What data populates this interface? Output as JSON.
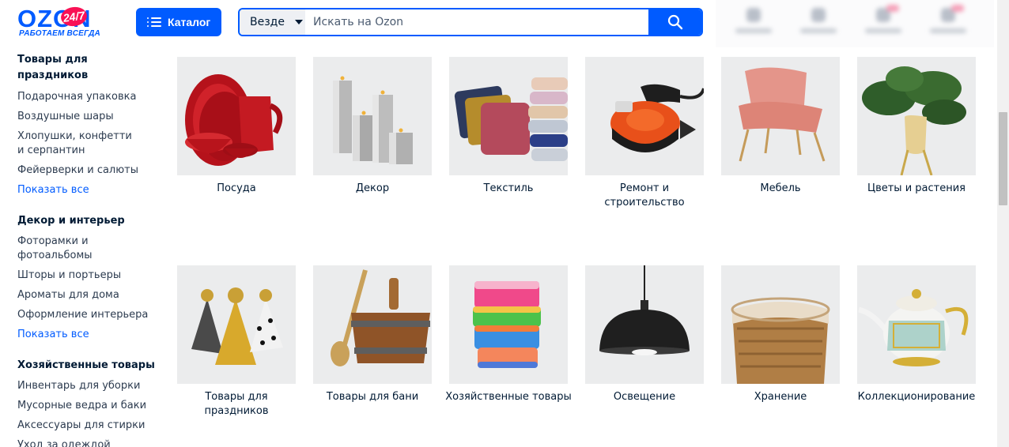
{
  "header": {
    "logo": {
      "word": "OZON",
      "badge": "24/7",
      "slogan": "РАБОТАЕМ ВСЕГДА"
    },
    "catalog_label": "Каталог",
    "search": {
      "scope": "Везде",
      "placeholder": "Искать на Ozon"
    }
  },
  "sidebar": {
    "sections": [
      {
        "title": "Товары для праздников",
        "items": [
          "Подарочная упаковка",
          "Воздушные шары",
          "Хлопушки, конфетти и серпантин",
          "Фейерверки и салюты"
        ],
        "more": "Показать все"
      },
      {
        "title": "Декор и интерьер",
        "items": [
          "Фоторамки и фотоальбомы",
          "Шторы и портьеры",
          "Ароматы для дома",
          "Оформление интерьера"
        ],
        "more": "Показать все"
      },
      {
        "title": "Хозяйственные товары",
        "items": [
          "Инвентарь для уборки",
          "Мусорные ведра и баки",
          "Аксессуары для стирки",
          "Уход за одеждой и обувью"
        ]
      }
    ]
  },
  "categories": [
    {
      "label": "Посуда",
      "icon": "dishes-icon"
    },
    {
      "label": "Декор",
      "icon": "candles-icon"
    },
    {
      "label": "Текстиль",
      "icon": "pillows-icon"
    },
    {
      "label": "Ремонт и строительство",
      "icon": "sander-icon"
    },
    {
      "label": "Мебель",
      "icon": "armchair-icon"
    },
    {
      "label": "Цветы и растения",
      "icon": "plant-icon"
    },
    {
      "label": "Товары для праздников",
      "icon": "party-hats-icon"
    },
    {
      "label": "Товары для бани",
      "icon": "sauna-bucket-icon"
    },
    {
      "label": "Хозяйственные товары",
      "icon": "sponges-icon"
    },
    {
      "label": "Освещение",
      "icon": "pendant-lamp-icon"
    },
    {
      "label": "Хранение",
      "icon": "basket-icon"
    },
    {
      "label": "Коллекционирование",
      "icon": "teapot-icon"
    }
  ],
  "colors": {
    "brand": "#005bff",
    "badge": "#f91155",
    "tile_bg": "#ebeced"
  }
}
